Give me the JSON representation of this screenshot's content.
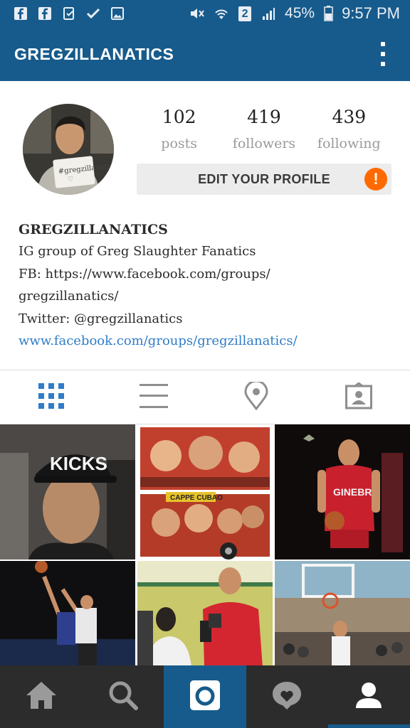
{
  "status_bar": {
    "battery_percent": "45%",
    "time": "9:57 PM",
    "sim_slot": "2",
    "left_icons": [
      "facebook-icon",
      "facebook-icon",
      "clipboard-icon",
      "check-icon",
      "image-icon"
    ],
    "right_icons": [
      "mute-icon",
      "wifi-icon",
      "sim-icon",
      "signal-icon",
      "battery-icon"
    ]
  },
  "app_bar": {
    "title": "GREGZILLANATICS",
    "menu_icon": "more-vert-icon"
  },
  "profile": {
    "stats": [
      {
        "count": "102",
        "label": "posts"
      },
      {
        "count": "419",
        "label": "followers"
      },
      {
        "count": "439",
        "label": "following"
      }
    ],
    "edit_button": "EDIT YOUR PROFILE",
    "warning_glyph": "!"
  },
  "bio": {
    "name": "GREGZILLANATICS",
    "lines": [
      "IG group of Greg Slaughter Fanatics",
      "FB: https://www.facebook.com/groups/",
      "gregzillanatics/",
      "Twitter: @gregzillanatics"
    ],
    "link": "www.facebook.com/groups/gregzillanatics/"
  },
  "tabs": [
    "grid-icon",
    "list-icon",
    "location-pin-icon",
    "tagged-photos-icon"
  ],
  "grid_photos": [
    {
      "name": "photo-kicks-cap-selfie",
      "caption": "KICKS"
    },
    {
      "name": "photo-comic-collage",
      "caption": "CAPPE CUBAO"
    },
    {
      "name": "photo-ginebra-player",
      "caption": "GINEBRA"
    },
    {
      "name": "photo-basketball-layup"
    },
    {
      "name": "photo-media-interview"
    },
    {
      "name": "photo-basketball-game"
    }
  ],
  "bottom_nav": [
    "home-icon",
    "search-icon",
    "camera-icon",
    "activity-heart-icon",
    "profile-icon"
  ],
  "colors": {
    "primary": "#175b8c",
    "warning": "#ff6a00",
    "link": "#2f7cc8",
    "nav_bg": "#2c2c2c"
  }
}
